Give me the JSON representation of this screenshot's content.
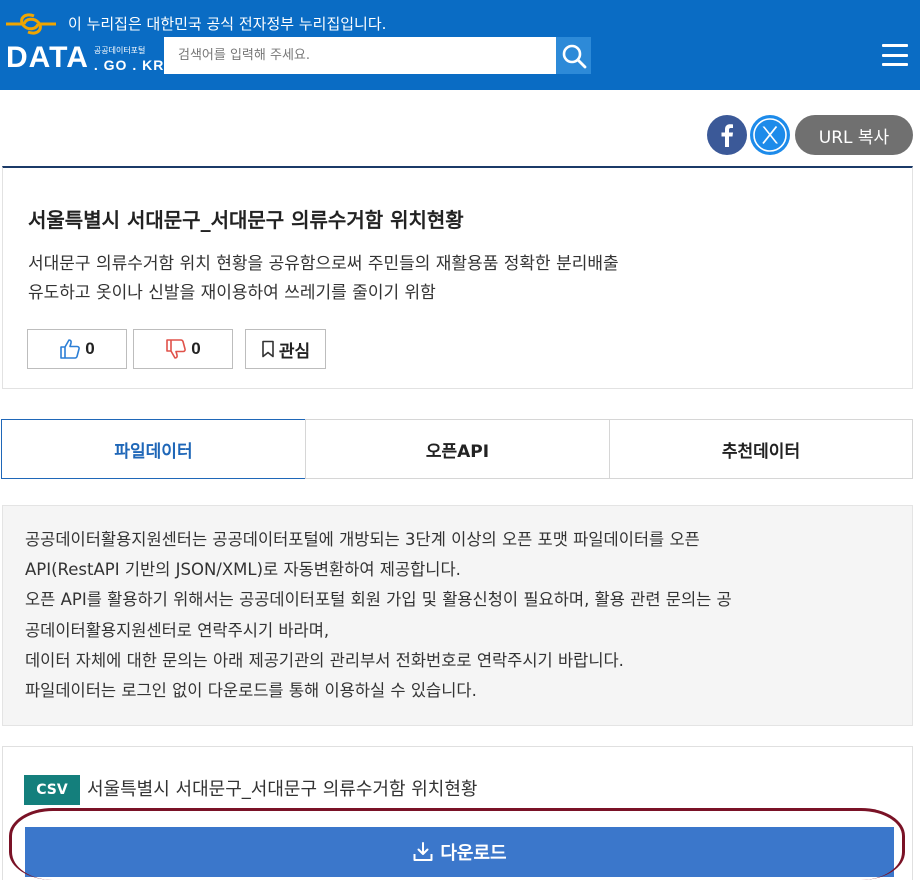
{
  "header": {
    "gov_notice": "이 누리집은 대한민국 공식 전자정부 누리집입니다.",
    "logo_main": "DATA",
    "logo_sub": "공공데이터포털",
    "logo_domain": ". GO . KR",
    "search_placeholder": "검색어를 입력해 주세요.",
    "colors": {
      "bar": "#0a6cc4",
      "search_button": "#2d8ad8"
    }
  },
  "share": {
    "facebook_icon": "facebook-icon",
    "x_icon": "x-icon",
    "url_copy_label": "URL 복사"
  },
  "dataset": {
    "title": "서울특별시 서대문구_서대문구 의류수거함 위치현황",
    "description_lines": [
      "서대문구 의류수거함 위치 현황을 공유함으로써 주민들의 재활용품 정확한 분리배출",
      "유도하고 옷이나 신발을 재이용하여 쓰레기를 줄이기 위함"
    ],
    "likes": "0",
    "dislikes": "0",
    "bookmark_label": "관심"
  },
  "tabs": [
    {
      "label": "파일데이터",
      "active": true
    },
    {
      "label": "오픈API",
      "active": false
    },
    {
      "label": "추천데이터",
      "active": false
    }
  ],
  "info_lines": [
    "공공데이터활용지원센터는 공공데이터포털에 개방되는 3단계 이상의 오픈 포맷 파일데이터를 오픈",
    "API(RestAPI 기반의 JSON/XML)로 자동변환하여 제공합니다.",
    "오픈 API를 활용하기 위해서는 공공데이터포털 회원 가입 및 활용신청이 필요하며, 활용 관련 문의는 공",
    "공데이터활용지원센터로 연락주시기 바라며,",
    "데이터 자체에 대한 문의는 아래 제공기관의 관리부서 전화번호로 연락주시기 바랍니다.",
    "파일데이터는 로그인 없이 다운로드를 통해 이용하실 수 있습니다."
  ],
  "file": {
    "format": "CSV",
    "name": "서울특별시 서대문구_서대문구 의류수거함 위치현황",
    "download_label": "다운로드",
    "colors": {
      "badge": "#147f7c",
      "download": "#3b77cb"
    }
  }
}
